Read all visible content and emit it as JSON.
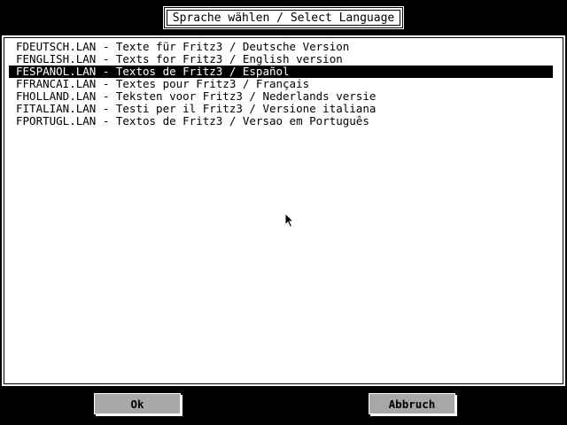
{
  "dialog": {
    "title": "Sprache wählen / Select Language"
  },
  "languages": [
    {
      "label": "FDEUTSCH.LAN - Texte für Fritz3 / Deutsche Version",
      "selected": false
    },
    {
      "label": "FENGLISH.LAN - Texts for Fritz3 / English version",
      "selected": false
    },
    {
      "label": "FESPANOL.LAN - Textos de Fritz3 / Español",
      "selected": true
    },
    {
      "label": "FFRANCAI.LAN - Textes pour Fritz3 / Français",
      "selected": false
    },
    {
      "label": "FHOLLAND.LAN - Teksten voor Fritz3 / Nederlands versie",
      "selected": false
    },
    {
      "label": "FITALIAN.LAN - Testi per il Fritz3 / Versione italiana",
      "selected": false
    },
    {
      "label": "FPORTUGL.LAN - Textos de Fritz3 / Versao em Português",
      "selected": false
    }
  ],
  "buttons": {
    "ok_label": "Ok",
    "cancel_label": "Abbruch"
  },
  "icons": {
    "cursor": "mouse-pointer-icon"
  },
  "colors": {
    "background": "#000000",
    "panel": "#ffffff",
    "selection": "#000000",
    "button": "#a8a8a8"
  }
}
